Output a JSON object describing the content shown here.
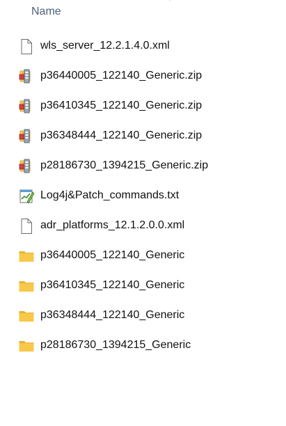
{
  "header": {
    "name_column": "Name"
  },
  "files": [
    {
      "name": "wls_server_12.2.1.4.0.xml",
      "icon": "xml-file-icon"
    },
    {
      "name": "p36440005_122140_Generic.zip",
      "icon": "zip-file-icon"
    },
    {
      "name": "p36410345_122140_Generic.zip",
      "icon": "zip-file-icon"
    },
    {
      "name": "p36348444_122140_Generic.zip",
      "icon": "zip-file-icon"
    },
    {
      "name": "p28186730_1394215_Generic.zip",
      "icon": "zip-file-icon"
    },
    {
      "name": "Log4j&Patch_commands.txt",
      "icon": "text-file-icon"
    },
    {
      "name": "adr_platforms_12.1.2.0.0.xml",
      "icon": "xml-file-icon"
    },
    {
      "name": "p36440005_122140_Generic",
      "icon": "folder-icon"
    },
    {
      "name": "p36410345_122140_Generic",
      "icon": "folder-icon"
    },
    {
      "name": "p36348444_122140_Generic",
      "icon": "folder-icon"
    },
    {
      "name": "p28186730_1394215_Generic",
      "icon": "folder-icon"
    }
  ],
  "colors": {
    "header_text": "#4c607a",
    "file_text": "#111111",
    "folder": "#f8c84a",
    "zip_binding": "#c9a23a"
  }
}
